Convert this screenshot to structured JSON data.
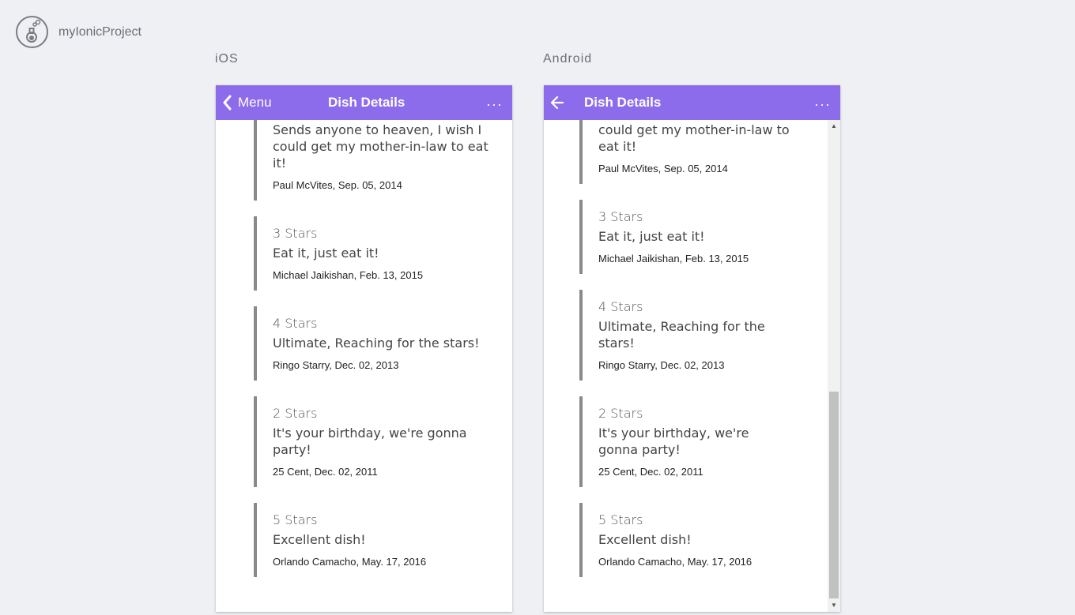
{
  "app": {
    "title": "myIonicProject"
  },
  "ios": {
    "label": "iOS",
    "back_label": "Menu",
    "title": "Dish Details",
    "more": "···"
  },
  "android": {
    "label": "Android",
    "title": "Dish Details",
    "more": "···"
  },
  "comments": [
    {
      "stars": "",
      "text": "Sends anyone to heaven, I wish I could get my mother-in-law to eat it!",
      "author": "Paul McVites, Sep. 05, 2014"
    },
    {
      "stars": "3 Stars",
      "text": "Eat it, just eat it!",
      "author": "Michael Jaikishan, Feb. 13, 2015"
    },
    {
      "stars": "4 Stars",
      "text": "Ultimate, Reaching for the stars!",
      "author": "Ringo Starry, Dec. 02, 2013"
    },
    {
      "stars": "2 Stars",
      "text": "It's your birthday, we're gonna party!",
      "author": "25 Cent, Dec. 02, 2011"
    },
    {
      "stars": "5 Stars",
      "text": "Excellent dish!",
      "author": "Orlando Camacho, May. 17, 2016"
    }
  ],
  "android_first_text": "could get my mother-in-law to eat it!",
  "colors": {
    "toolbar": "#8d6cec",
    "background": "#eff0f4",
    "accent_border": "#8a8a8a"
  },
  "icons": {
    "ios_back": "chevron-left-icon",
    "android_back": "arrow-left-icon",
    "more": "ellipsis-icon",
    "logo": "flask-icon"
  }
}
